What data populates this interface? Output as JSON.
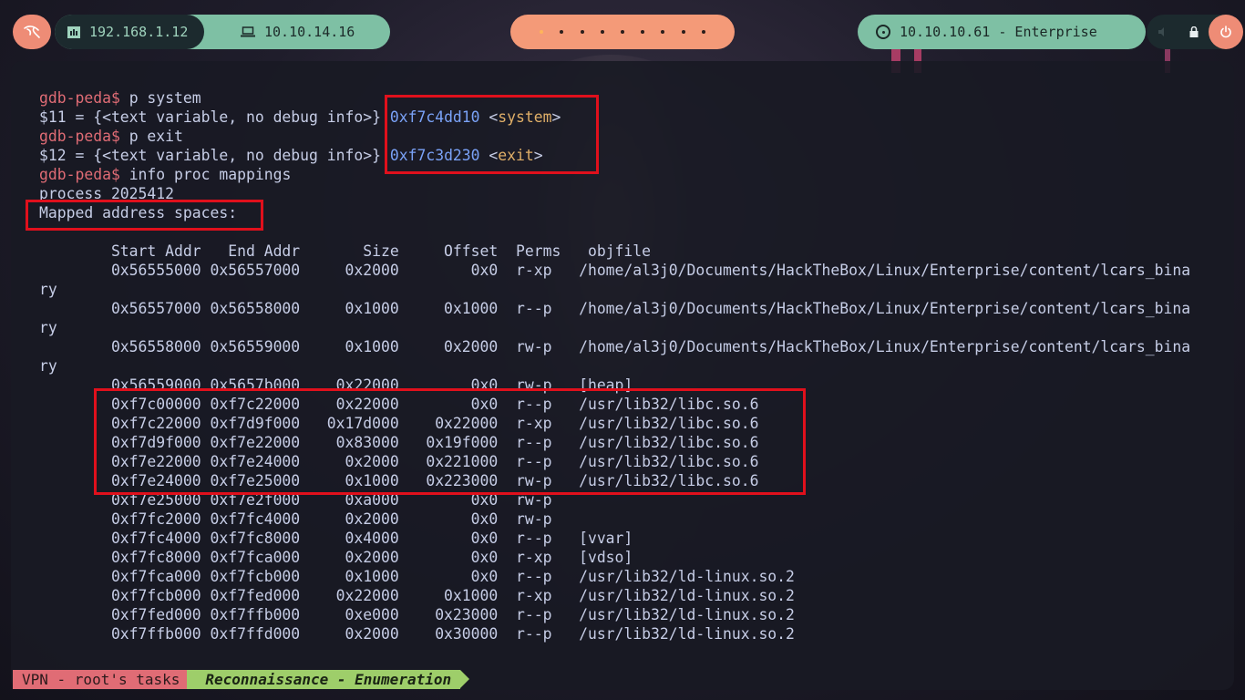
{
  "topbar": {
    "local_ip": "192.168.1.12",
    "vpn_ip": "10.10.14.16",
    "target": "10.10.10.61 - Enterprise",
    "workspaces": 9,
    "active_workspace": 1
  },
  "terminal": {
    "lines": [
      [
        {
          "t": "gdb-peda$ ",
          "c": "prompt"
        },
        {
          "t": "p system",
          "c": "plain"
        }
      ],
      [
        {
          "t": "$11 = {<text variable, no debug info>} ",
          "c": "plain"
        },
        {
          "t": "0xf7c4dd10",
          "c": "addr"
        },
        {
          "t": " <",
          "c": "plain"
        },
        {
          "t": "system",
          "c": "sym"
        },
        {
          "t": ">",
          "c": "plain"
        }
      ],
      [
        {
          "t": "gdb-peda$ ",
          "c": "prompt"
        },
        {
          "t": "p exit",
          "c": "plain"
        }
      ],
      [
        {
          "t": "$12 = {<text variable, no debug info>} ",
          "c": "plain"
        },
        {
          "t": "0xf7c3d230",
          "c": "addr"
        },
        {
          "t": " <",
          "c": "plain"
        },
        {
          "t": "exit",
          "c": "sym"
        },
        {
          "t": ">",
          "c": "plain"
        }
      ],
      [
        {
          "t": "gdb-peda$ ",
          "c": "prompt"
        },
        {
          "t": "info proc mappings",
          "c": "plain"
        }
      ],
      [
        {
          "t": "process 2025412",
          "c": "plain"
        }
      ],
      [
        {
          "t": "Mapped address spaces:",
          "c": "plain"
        }
      ],
      [
        {
          "t": "",
          "c": "plain"
        }
      ],
      [
        {
          "t": "        Start Addr   End Addr       Size     Offset  Perms   objfile",
          "c": "plain"
        }
      ],
      [
        {
          "t": "        0x56555000 0x56557000     0x2000        0x0  r-xp   /home/al3j0/Documents/HackTheBox/Linux/Enterprise/content/lcars_bina",
          "c": "plain"
        }
      ],
      [
        {
          "t": "ry",
          "c": "plain"
        }
      ],
      [
        {
          "t": "        0x56557000 0x56558000     0x1000     0x1000  r--p   /home/al3j0/Documents/HackTheBox/Linux/Enterprise/content/lcars_bina",
          "c": "plain"
        }
      ],
      [
        {
          "t": "ry",
          "c": "plain"
        }
      ],
      [
        {
          "t": "        0x56558000 0x56559000     0x1000     0x2000  rw-p   /home/al3j0/Documents/HackTheBox/Linux/Enterprise/content/lcars_bina",
          "c": "plain"
        }
      ],
      [
        {
          "t": "ry",
          "c": "plain"
        }
      ],
      [
        {
          "t": "        0x56559000 0x5657b000    0x22000        0x0  rw-p   [heap]",
          "c": "plain"
        }
      ],
      [
        {
          "t": "        0xf7c00000 0xf7c22000    0x22000        0x0  r--p   /usr/lib32/libc.so.6",
          "c": "plain"
        }
      ],
      [
        {
          "t": "        0xf7c22000 0xf7d9f000   0x17d000    0x22000  r-xp   /usr/lib32/libc.so.6",
          "c": "plain"
        }
      ],
      [
        {
          "t": "        0xf7d9f000 0xf7e22000    0x83000   0x19f000  r--p   /usr/lib32/libc.so.6",
          "c": "plain"
        }
      ],
      [
        {
          "t": "        0xf7e22000 0xf7e24000     0x2000   0x221000  r--p   /usr/lib32/libc.so.6",
          "c": "plain"
        }
      ],
      [
        {
          "t": "        0xf7e24000 0xf7e25000     0x1000   0x223000  rw-p   /usr/lib32/libc.so.6",
          "c": "plain"
        }
      ],
      [
        {
          "t": "        0xf7e25000 0xf7e2f000     0xa000        0x0  rw-p",
          "c": "plain"
        }
      ],
      [
        {
          "t": "        0xf7fc2000 0xf7fc4000     0x2000        0x0  rw-p",
          "c": "plain"
        }
      ],
      [
        {
          "t": "        0xf7fc4000 0xf7fc8000     0x4000        0x0  r--p   [vvar]",
          "c": "plain"
        }
      ],
      [
        {
          "t": "        0xf7fc8000 0xf7fca000     0x2000        0x0  r-xp   [vdso]",
          "c": "plain"
        }
      ],
      [
        {
          "t": "        0xf7fca000 0xf7fcb000     0x1000        0x0  r--p   /usr/lib32/ld-linux.so.2",
          "c": "plain"
        }
      ],
      [
        {
          "t": "        0xf7fcb000 0xf7fed000    0x22000     0x1000  r-xp   /usr/lib32/ld-linux.so.2",
          "c": "plain"
        }
      ],
      [
        {
          "t": "        0xf7fed000 0xf7ffb000     0xe000    0x23000  r--p   /usr/lib32/ld-linux.so.2",
          "c": "plain"
        }
      ],
      [
        {
          "t": "        0xf7ffb000 0xf7ffd000     0x2000    0x30000  r--p   /usr/lib32/ld-linux.so.2",
          "c": "plain"
        }
      ]
    ]
  },
  "statusbar": {
    "session": "VPN - root's tasks",
    "window": "Reconnaissance - Enumeration"
  },
  "colors": {
    "prompt": "#e06c75",
    "address": "#7aa2f7",
    "symbol": "#e0af68",
    "highlight_box": "#e0101c"
  }
}
